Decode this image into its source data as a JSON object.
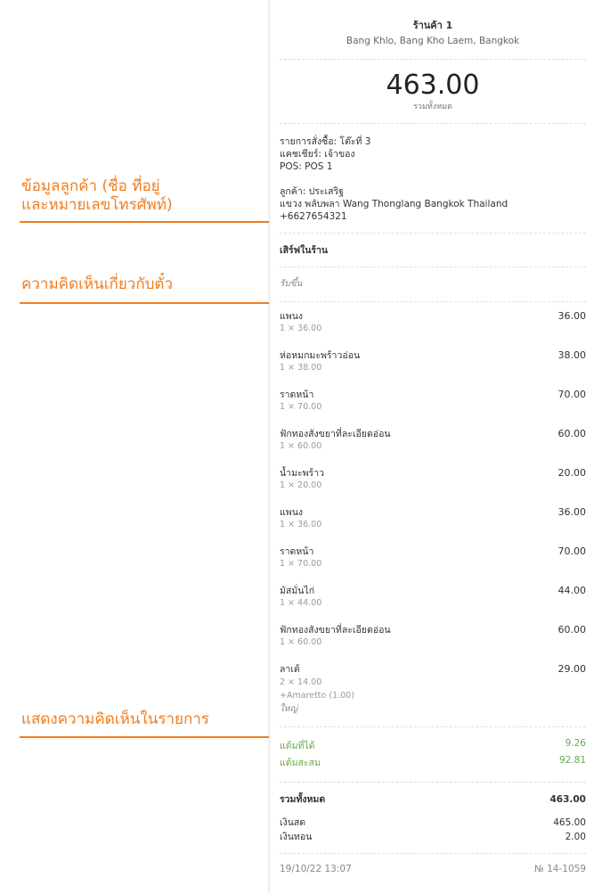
{
  "annotations": {
    "customer_info_line1": "ข้อมูลลูกค้า (ชื่อ ที่อยู่",
    "customer_info_line2": "และหมายเลขโทรศัพท์)",
    "ticket_comment": "ความคิดเห็นเกี่ยวกับตั๋ว",
    "item_comment": "แสดงความคิดเห็นในรายการ",
    "color": "#f07d1f"
  },
  "receipt": {
    "store_name": "ร้านค้า 1",
    "store_address": "Bang Khlo, Bang Kho Laem, Bangkok",
    "total_amount": "463.00",
    "total_caption": "รวมทั้งหมด",
    "order_line": "รายการสั่งซื้อ: โต๊ะที่ 3",
    "cashier_line": "แคชเชียร์: เจ้าของ",
    "pos_line": "POS: POS 1",
    "customer_line": "ลูกค้า: ประเสริฐ",
    "address_line": "แขวง พลับพลา Wang Thonglang Bangkok Thailand",
    "phone_line": "+6627654321",
    "dining_option": "เสิร์ฟในร้าน",
    "ticket_comment": "รับขึ้น",
    "items": [
      {
        "name": "แพนง",
        "price": "36.00",
        "qty": "1 × 36.00"
      },
      {
        "name": "ห่อหมกมะพร้าวอ่อน",
        "price": "38.00",
        "qty": "1 × 38.00"
      },
      {
        "name": "ราดหน้า",
        "price": "70.00",
        "qty": "1 × 70.00"
      },
      {
        "name": "ฟักทองสังขยาที่ละเอียดอ่อน",
        "price": "60.00",
        "qty": "1 × 60.00"
      },
      {
        "name": "น้ำมะพร้าว",
        "price": "20.00",
        "qty": "1 × 20.00"
      },
      {
        "name": "แพนง",
        "price": "36.00",
        "qty": "1 × 36.00"
      },
      {
        "name": "ราดหน้า",
        "price": "70.00",
        "qty": "1 × 70.00"
      },
      {
        "name": "มัสมั่นไก่",
        "price": "44.00",
        "qty": "1 × 44.00"
      },
      {
        "name": "ฟักทองสังขยาที่ละเอียดอ่อน",
        "price": "60.00",
        "qty": "1 × 60.00"
      },
      {
        "name": "ลาเต้",
        "price": "29.00",
        "qty": "2 × 14.00",
        "modifier": "+Amaretto (1.00)",
        "comment": "ใหญ่"
      }
    ],
    "points_earned_label": "แต้มที่ได้",
    "points_earned_value": "9.26",
    "points_balance_label": "แต้มสะสม",
    "points_balance_value": "92.81",
    "total_label": "รวมทั้งหมด",
    "total_value": "463.00",
    "cash_label": "เงินสด",
    "cash_value": "465.00",
    "change_label": "เงินทอน",
    "change_value": "2.00",
    "datetime": "19/10/22 13:07",
    "receipt_number": "№ 14-1059"
  }
}
